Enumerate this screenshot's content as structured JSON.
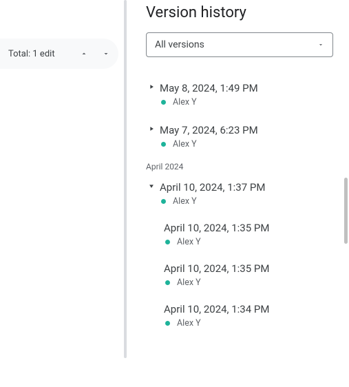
{
  "leftPanel": {
    "totalText": "Total: 1 edit"
  },
  "rightPanel": {
    "title": "Version history",
    "dropdownLabel": "All versions",
    "versions": [
      {
        "date": "May 8, 2024, 1:49 PM",
        "author": "Alex Y",
        "expanded": false
      },
      {
        "date": "May 7, 2024, 6:23 PM",
        "author": "Alex Y",
        "expanded": false
      }
    ],
    "monthHeader": "April 2024",
    "expandedVersion": {
      "date": "April 10, 2024, 1:37 PM",
      "author": "Alex Y",
      "subVersions": [
        {
          "date": "April 10, 2024, 1:35 PM",
          "author": "Alex Y"
        },
        {
          "date": "April 10, 2024, 1:35 PM",
          "author": "Alex Y"
        },
        {
          "date": "April 10, 2024, 1:34 PM",
          "author": "Alex Y"
        }
      ]
    }
  },
  "colors": {
    "authorDot": "#1eb39a"
  }
}
